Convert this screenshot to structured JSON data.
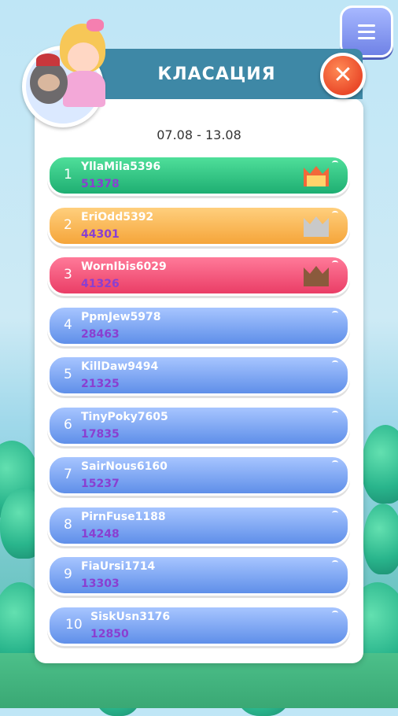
{
  "header": {
    "title": "КЛАСАЦИЯ"
  },
  "date_range": "07.08 - 13.08",
  "colors": {
    "gold": "#f2683a",
    "silver": "#c9c9c9",
    "bronze": "#8a5a3c"
  },
  "icons": {
    "menu": "menu-icon",
    "close": "close-icon",
    "crown": "crown-icon",
    "avatar": "player-avatar"
  },
  "leaderboard": [
    {
      "rank": "1",
      "name": "YllaMila5396",
      "score": "51378",
      "style": "green",
      "crown": "gold"
    },
    {
      "rank": "2",
      "name": "EriOdd5392",
      "score": "44301",
      "style": "orange",
      "crown": "silver"
    },
    {
      "rank": "3",
      "name": "WornIbis6029",
      "score": "41326",
      "style": "pink",
      "crown": "bronze"
    },
    {
      "rank": "4",
      "name": "PpmJew5978",
      "score": "28463",
      "style": "blue"
    },
    {
      "rank": "5",
      "name": "KillDaw9494",
      "score": "21325",
      "style": "blue"
    },
    {
      "rank": "6",
      "name": "TinyPoky7605",
      "score": "17835",
      "style": "blue"
    },
    {
      "rank": "7",
      "name": "SairNous6160",
      "score": "15237",
      "style": "blue"
    },
    {
      "rank": "8",
      "name": "PirnFuse1188",
      "score": "14248",
      "style": "blue"
    },
    {
      "rank": "9",
      "name": "FiaUrsi1714",
      "score": "13303",
      "style": "blue"
    },
    {
      "rank": "10",
      "name": "SiskUsn3176",
      "score": "12850",
      "style": "blue"
    }
  ]
}
